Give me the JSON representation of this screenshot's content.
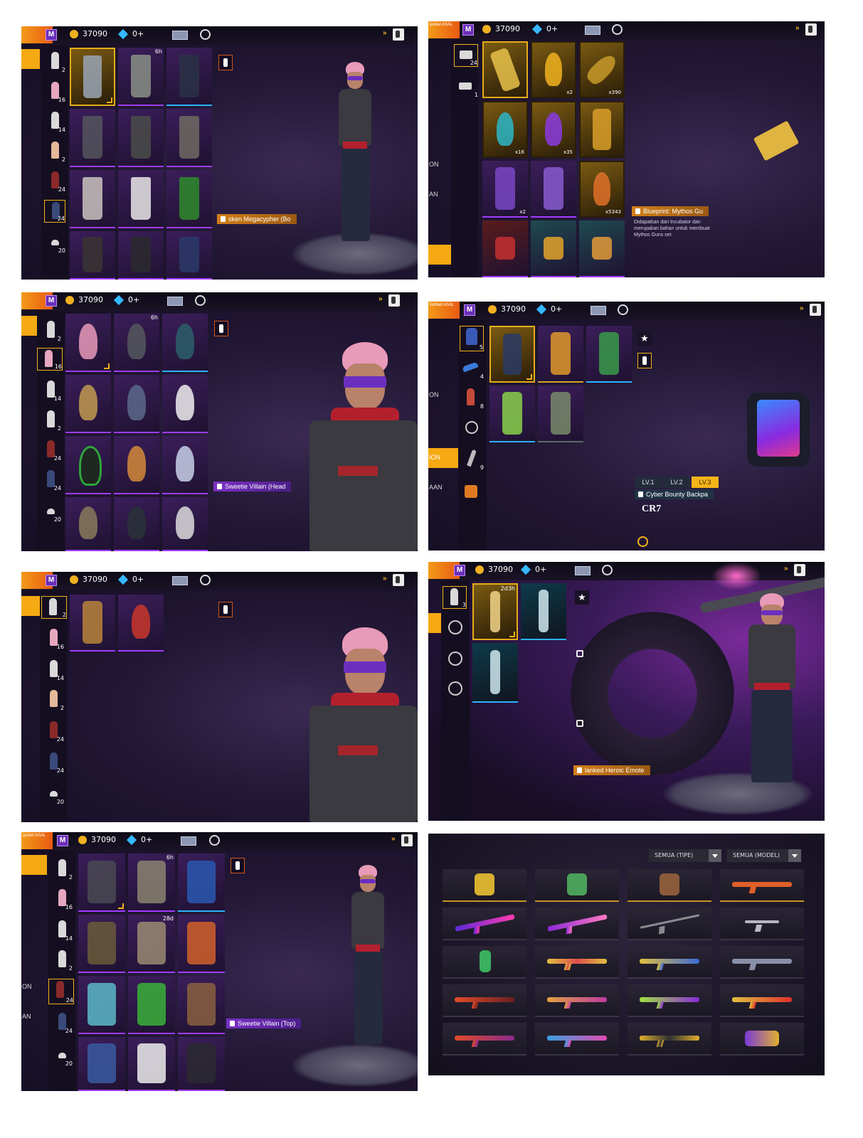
{
  "hud": {
    "coins": "37090",
    "diamonds": "0+",
    "corner_text_a": "ipsbel ASAL",
    "corner_text_b": "lombel ASAL"
  },
  "panels": {
    "p1": {
      "rail_counts": [
        "2",
        "16",
        "14",
        "2",
        "24",
        "24",
        "20"
      ],
      "tile_tag": "6h",
      "label": "sken Megacypher (Bo"
    },
    "p2": {
      "rail_counts": [
        "24",
        "1"
      ],
      "tile_counts": [
        "x2",
        "x390",
        "x16",
        "x35",
        "x2",
        "x5343"
      ],
      "edge_texts": [
        "ON",
        "AN"
      ],
      "item_title": "Blueprint: Mythos Gu",
      "item_desc": "Didapatkan dari Incubator dan merupakan bahan untuk membuat Mythos Guns set"
    },
    "p3": {
      "rail_counts": [
        "2",
        "16",
        "14",
        "2",
        "24",
        "24",
        "20"
      ],
      "tile_tag": "6h",
      "label": "Sweetie Villain (Head"
    },
    "p4": {
      "rail_counts": [
        "5",
        "4",
        "8",
        "9"
      ],
      "edge_texts": [
        "ON",
        "ION",
        "AAN"
      ],
      "levels": [
        "LV.1",
        "LV.2",
        "LV.3"
      ],
      "item_title": "Cyber Bounty Backpa",
      "brand": "CR7"
    },
    "p5": {
      "rail_counts": [
        "2",
        "16",
        "14",
        "2",
        "24",
        "24",
        "20"
      ]
    },
    "p6": {
      "rail_counts": [
        "3"
      ],
      "tile_tag": "2d3h",
      "label": "lanked Heroic Emote"
    },
    "p7": {
      "rail_counts": [
        "2",
        "16",
        "14",
        "2",
        "24",
        "24",
        "20"
      ],
      "tile_tags": [
        "6h",
        "28d"
      ],
      "edge_texts": [
        "ON",
        "AN"
      ],
      "label": "Sweetie Villain (Top)"
    },
    "p8": {
      "filter_type": "SEMUA (TIPE)",
      "filter_model": "SEMUA (MODEL)"
    }
  },
  "icons": {
    "back": "back-arrow-icon",
    "settings": "gear-icon",
    "forward": "double-chevron-icon",
    "ticket": "ticket-icon",
    "star": "star-icon",
    "lock": "lock-icon",
    "mannequin": "mannequin-icon"
  },
  "colors": {
    "accent_orange": "#f5a912",
    "rare_purple": "#a23bff",
    "epic_gold": "#e5ad17",
    "diamond_blue": "#35b8ff",
    "hair_pink": "#e89ab9",
    "hood_red": "#b3202d"
  }
}
